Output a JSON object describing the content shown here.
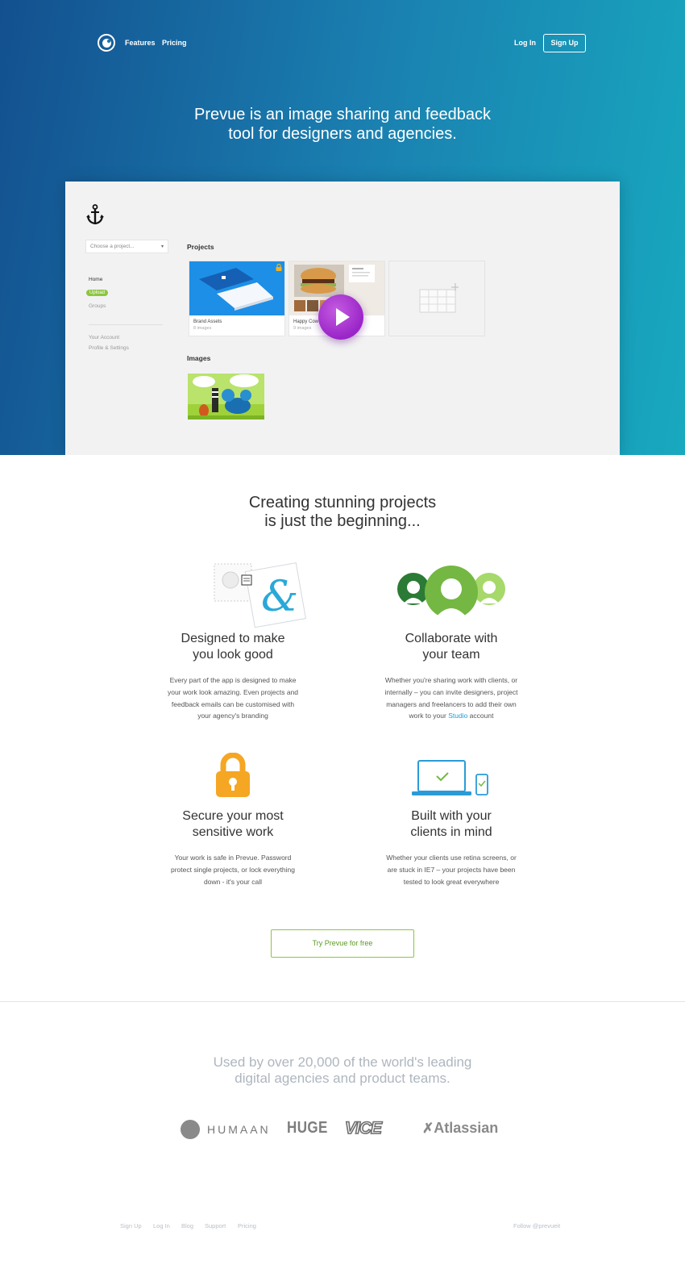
{
  "nav": {
    "features": "Features",
    "pricing": "Pricing",
    "login": "Log In",
    "signup": "Sign Up"
  },
  "hero": {
    "title_line1": "Prevue is an image sharing and feedback",
    "title_line2": "tool for designers and agencies."
  },
  "app_preview": {
    "select_placeholder": "Choose a project...",
    "sidebar": {
      "home": "Home",
      "upload": "Upload",
      "groups": "Groups",
      "your_account": "Your Account",
      "profile_settings": "Profile & Settings"
    },
    "projects_label": "Projects",
    "projects": [
      {
        "title": "Brand Assets",
        "count": "8 images"
      },
      {
        "title": "Happy Cow",
        "count": "9 images"
      }
    ],
    "images_label": "Images"
  },
  "features": {
    "title_line1": "Creating stunning projects",
    "title_line2": "is just the beginning...",
    "items": [
      {
        "icon": "design-icon",
        "title_line1": "Designed to make",
        "title_line2": "you look good",
        "text_lines": [
          "Every part of the app is designed to make",
          "your work look amazing. Even projects and",
          "feedback emails can be customised with",
          "your agency's branding"
        ]
      },
      {
        "icon": "team-icon",
        "title_line1": "Collaborate with",
        "title_line2": "your team",
        "text_lines": [
          "Whether you're sharing work with clients, or",
          "internally – you can invite designers, project",
          "managers and freelancers to add their own"
        ],
        "text_last_prefix": "work to your ",
        "text_link": "Studio",
        "text_last_suffix": " account"
      },
      {
        "icon": "lock-icon",
        "title_line1": "Secure your most",
        "title_line2": "sensitive work",
        "text_lines": [
          "Your work is safe in Prevue. Password",
          "protect single projects, or lock everything",
          "down - it's your call"
        ]
      },
      {
        "icon": "devices-icon",
        "title_line1": "Built with your",
        "title_line2": "clients in mind",
        "text_lines": [
          "Whether your clients use retina screens, or",
          "are stuck in IE7 – your projects have been",
          "tested to look great everywhere"
        ]
      }
    ],
    "cta": "Try Prevue for free"
  },
  "customers": {
    "title_line1": "Used by over 20,000 of the world's leading",
    "title_line2": "digital agencies and product teams.",
    "logos": [
      "HUMAAN",
      "HUGE",
      "VICE",
      "Atlassian"
    ]
  },
  "footer": {
    "links": [
      "Sign Up",
      "Log In",
      "Blog",
      "Support",
      "Pricing"
    ],
    "follow": "Follow @prevueit"
  },
  "colors": {
    "hero_start": "#13508f",
    "hero_end": "#18a9bf",
    "green": "#8cc63e",
    "purple": "#9a25c8",
    "blue": "#1a9cd8",
    "orange": "#f5a623"
  }
}
